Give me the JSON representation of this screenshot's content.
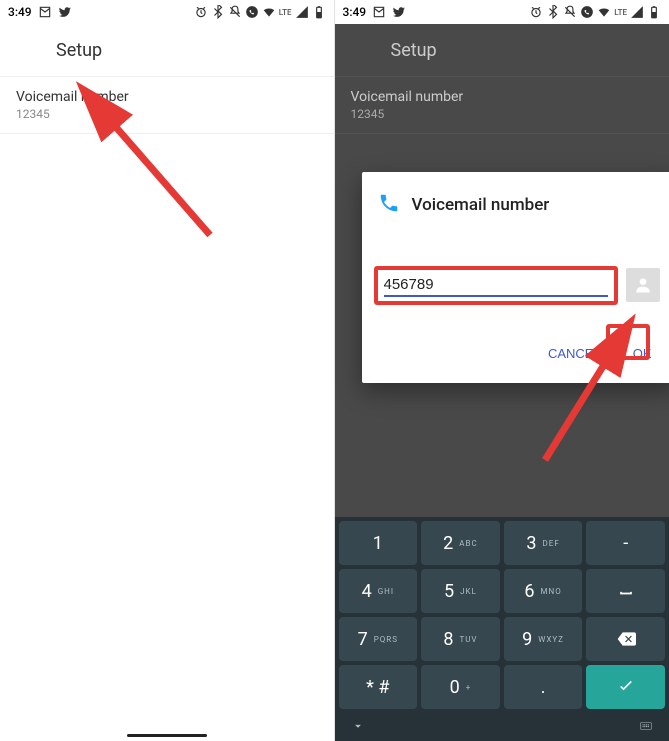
{
  "status": {
    "time": "3:49",
    "lte": "LTE"
  },
  "setup": {
    "title": "Setup",
    "row_label": "Voicemail number",
    "row_value": "12345"
  },
  "dialog": {
    "title": "Voicemail number",
    "value": "456789",
    "cancel": "CANCEL",
    "ok": "OK"
  },
  "keypad": {
    "keys": [
      [
        {
          "n": "1",
          "s": ""
        },
        {
          "n": "2",
          "s": "ABC"
        },
        {
          "n": "3",
          "s": "DEF"
        },
        {
          "n": "-",
          "s": "",
          "action": true
        }
      ],
      [
        {
          "n": "4",
          "s": "GHI"
        },
        {
          "n": "5",
          "s": "JKL"
        },
        {
          "n": "6",
          "s": "MNO"
        },
        {
          "n": "␣",
          "s": "",
          "action": true,
          "icon": "space"
        }
      ],
      [
        {
          "n": "7",
          "s": "PQRS"
        },
        {
          "n": "8",
          "s": "TUV"
        },
        {
          "n": "9",
          "s": "WXYZ"
        },
        {
          "n": "",
          "s": "",
          "action": true,
          "icon": "backspace"
        }
      ],
      [
        {
          "n": "* #",
          "s": "",
          "wide": false
        },
        {
          "n": "0",
          "s": "+"
        },
        {
          "n": ".",
          "s": ""
        },
        {
          "n": "",
          "s": "",
          "accent": true,
          "icon": "check"
        }
      ]
    ]
  }
}
